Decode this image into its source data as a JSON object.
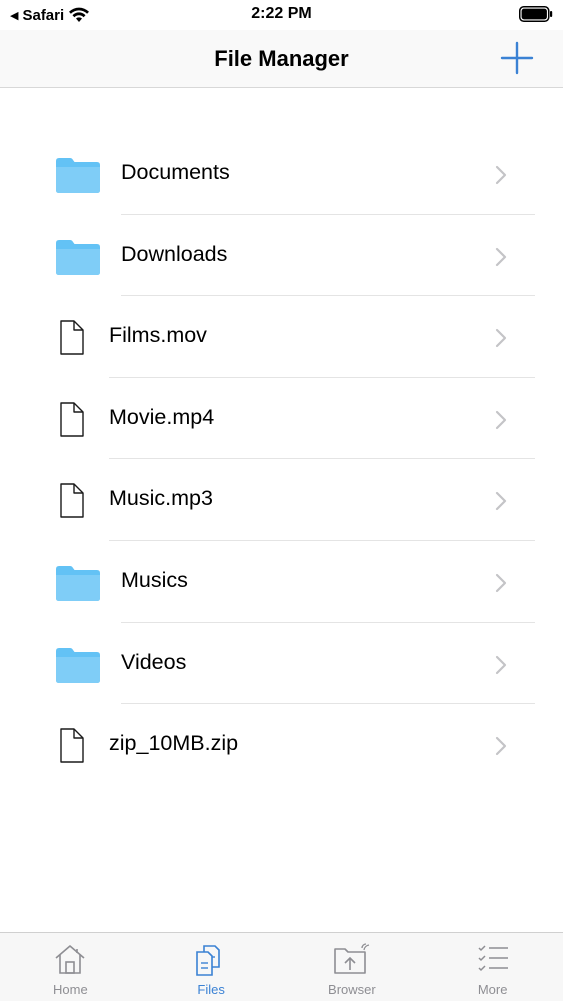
{
  "status_bar": {
    "back_app": "Safari",
    "time": "2:22 PM"
  },
  "nav": {
    "title": "File Manager",
    "add_icon": "plus-icon"
  },
  "colors": {
    "accent": "#3b82d4",
    "folder": "#63c2f5",
    "inactive": "#8e8e93"
  },
  "files": [
    {
      "name": "Documents",
      "type": "folder"
    },
    {
      "name": "Downloads",
      "type": "folder"
    },
    {
      "name": "Films.mov",
      "type": "file"
    },
    {
      "name": "Movie.mp4",
      "type": "file"
    },
    {
      "name": "Music.mp3",
      "type": "file"
    },
    {
      "name": "Musics",
      "type": "folder"
    },
    {
      "name": "Videos",
      "type": "folder"
    },
    {
      "name": "zip_10MB.zip",
      "type": "file"
    }
  ],
  "tabs": [
    {
      "label": "Home",
      "icon": "home-icon",
      "active": false
    },
    {
      "label": "Files",
      "icon": "files-icon",
      "active": true
    },
    {
      "label": "Browser",
      "icon": "browser-icon",
      "active": false
    },
    {
      "label": "More",
      "icon": "more-icon",
      "active": false
    }
  ]
}
